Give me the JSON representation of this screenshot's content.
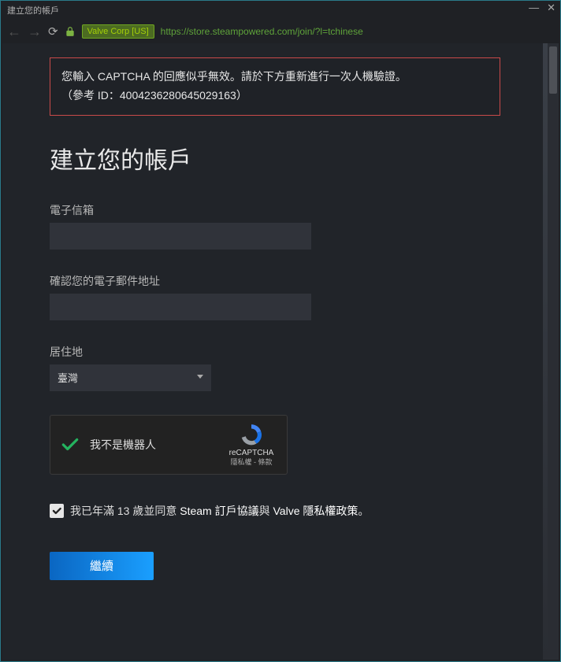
{
  "window": {
    "title": "建立您的帳戶",
    "cert_label": "Valve Corp [US]",
    "url": "https://store.steampowered.com/join/?l=tchinese"
  },
  "error": {
    "line1": "您輸入 CAPTCHA 的回應似乎無效。請於下方重新進行一次人機驗證。",
    "line2": "（參考 ID：4004236280645029163）"
  },
  "page_title": "建立您的帳戶",
  "form": {
    "email_label": "電子信箱",
    "email_value": "",
    "confirm_email_label": "確認您的電子郵件地址",
    "confirm_email_value": "",
    "country_label": "居住地",
    "country_value": "臺灣"
  },
  "recaptcha": {
    "label": "我不是機器人",
    "brand": "reCAPTCHA",
    "legal": "隱私權 - 條款"
  },
  "agree": {
    "prefix": "我已年滿 13 歲並同意 ",
    "link1": "Steam 訂戶協議",
    "mid": "與 ",
    "link2": "Valve 隱私權政策",
    "suffix": "。"
  },
  "continue_label": "繼續"
}
